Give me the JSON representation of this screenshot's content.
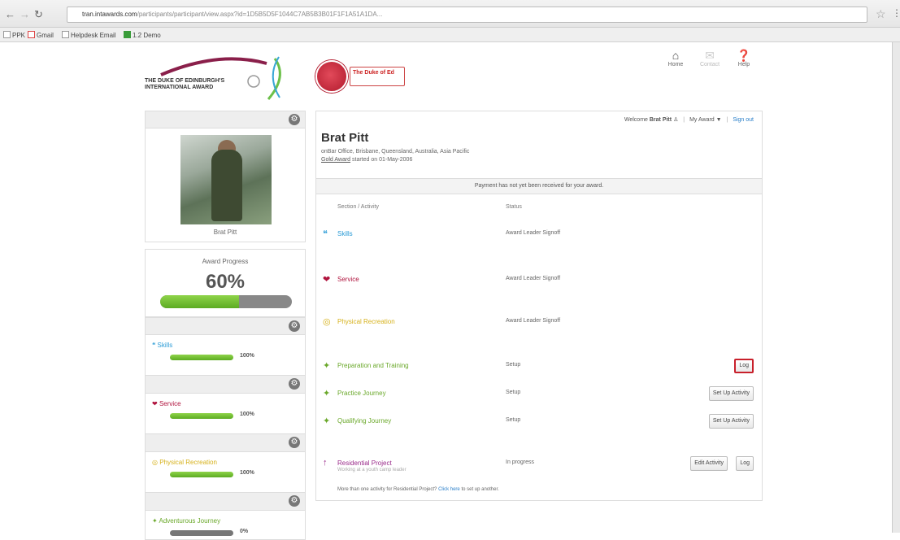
{
  "browser": {
    "url_domain": "tran.intawards.com",
    "url_path": "/participants/participant/view.aspx?id=1D5B5D5F1044C7AB5B3B01F1F1A51A1DA...",
    "bookmarks": [
      "PPK",
      "Gmail",
      "Helpdesk Email",
      "1.2 Demo"
    ]
  },
  "header": {
    "logo_text_line1": "THE DUKE OF EDINBURGH'S",
    "logo_text_line2": "INTERNATIONAL AWARD",
    "badge_text": "The Duke of Ed",
    "nav": [
      {
        "label": "Home",
        "icon": "home-icon"
      },
      {
        "label": "Contact",
        "icon": "contact-icon"
      },
      {
        "label": "Help",
        "icon": "help-icon"
      }
    ]
  },
  "profile": {
    "name": "Brat Pitt",
    "progress_label": "Award Progress",
    "progress_percent": "60%",
    "progress_value": 0.6
  },
  "left_sections": [
    {
      "title": "Skills",
      "percent": "100%",
      "fill": 1.0,
      "color": "#2a9bd6",
      "icon": "speech-bubble-icon"
    },
    {
      "title": "Service",
      "percent": "100%",
      "fill": 1.0,
      "color": "#b0143e",
      "icon": "hands-icon"
    },
    {
      "title": "Physical Recreation",
      "percent": "100%",
      "fill": 1.0,
      "color": "#d6b11a",
      "icon": "runner-icon"
    },
    {
      "title": "Adventurous Journey",
      "percent": "0%",
      "fill": 0.0,
      "color": "#6aa82a",
      "icon": "compass-icon"
    }
  ],
  "main": {
    "welcome_prefix": "Welcome",
    "welcome_name": "Brat Pitt",
    "my_award": "My Award",
    "signout": "Sign out",
    "user_name": "Brat Pitt",
    "location": "onBar Office, Brisbane, Queensland, Australia, Asia Pacific",
    "award_link": "Gold Award",
    "award_started": "started on 01-May-2006",
    "notice": "Payment has not yet been received for your award.",
    "col_section": "Section / Activity",
    "col_status": "Status",
    "rows": [
      {
        "name": "Skills",
        "status": "Award Leader Signoff",
        "color": "#2a9bd6",
        "icon": "speech-bubble-icon",
        "buttons": []
      },
      {
        "name": "Service",
        "status": "Award Leader Signoff",
        "color": "#b0143e",
        "icon": "hands-icon",
        "buttons": []
      },
      {
        "name": "Physical Recreation",
        "status": "Award Leader Signoff",
        "color": "#d6b11a",
        "icon": "runner-icon",
        "buttons": []
      },
      {
        "name": "Preparation and Training",
        "status": "Setup",
        "color": "#6aa82a",
        "icon": "compass-icon",
        "buttons": [
          "Log"
        ]
      },
      {
        "name": "Practice Journey",
        "status": "Setup",
        "color": "#6aa82a",
        "icon": "compass-icon",
        "buttons": [
          "Set Up Activity"
        ]
      },
      {
        "name": "Qualifying Journey",
        "status": "Setup",
        "color": "#6aa82a",
        "icon": "compass-icon",
        "buttons": [
          "Set Up Activity"
        ]
      },
      {
        "name": "Residential Project",
        "sub": "Working at a youth camp leader",
        "status": "In progress",
        "color": "#9a2a8a",
        "icon": "residential-icon",
        "buttons": [
          "Edit Activity",
          "Log"
        ]
      }
    ],
    "footnote_text": "More than one activity for Residential Project?",
    "footnote_link": "Click here",
    "footnote_suffix": "to set up another."
  }
}
